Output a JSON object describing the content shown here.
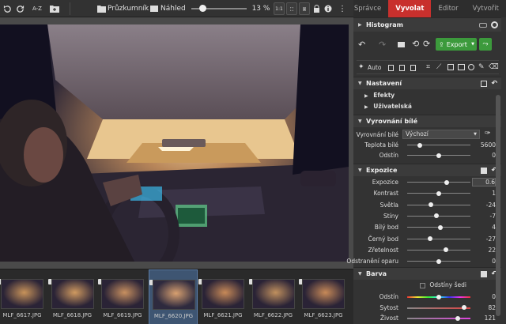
{
  "toolbar": {
    "browser_label": "Průzkumník",
    "preview_label": "Náhled",
    "zoom": "13 %",
    "zoom_fraction": 0.2,
    "sort_label": "A-Z"
  },
  "modes": [
    "Správce",
    "Vyvolat",
    "Editor",
    "Vytvořit"
  ],
  "active_mode": "Vyvolat",
  "panel": {
    "histogram_label": "Histogram",
    "export_label": "Export",
    "auto_label": "Auto",
    "settings_label": "Nastavení",
    "effects_label": "Efekty",
    "user_label": "Uživatelská",
    "wb_section": "Vyrovnání bílé",
    "wb_field_label": "Vyrovnání bílé",
    "wb_value": "Výchozí",
    "exposure_section": "Expozice",
    "color_section": "Barva",
    "gray_label": "Odstíny šedi"
  },
  "wb_rows": [
    {
      "label": "Teplota bílé",
      "value": "5600",
      "pos": 0.2
    },
    {
      "label": "Odstín",
      "value": "0",
      "pos": 0.5
    }
  ],
  "exposure_rows": [
    {
      "label": "Expozice",
      "value": "0.6",
      "pos": 0.62
    },
    {
      "label": "Kontrast",
      "value": "1",
      "pos": 0.5
    },
    {
      "label": "Světla",
      "value": "-24",
      "pos": 0.38
    },
    {
      "label": "Stíny",
      "value": "-7",
      "pos": 0.46
    },
    {
      "label": "Bílý bod",
      "value": "4",
      "pos": 0.52
    },
    {
      "label": "Černý bod",
      "value": "-27",
      "pos": 0.36
    },
    {
      "label": "Zřetelnost",
      "value": "22",
      "pos": 0.61
    },
    {
      "label": "Odstranění oparu",
      "value": "0",
      "pos": 0.5
    }
  ],
  "color_rows": [
    {
      "label": "Odstín",
      "value": "0",
      "pos": 0.5
    },
    {
      "label": "Sytost",
      "value": "82",
      "pos": 0.9
    },
    {
      "label": "Živost",
      "value": "121",
      "pos": 0.8
    }
  ],
  "thumbnails": [
    {
      "label": "MLF_6617.JPG"
    },
    {
      "label": "MLF_6618.JPG"
    },
    {
      "label": "MLF_6619.JPG"
    },
    {
      "label": "MLF_6620.JPG",
      "selected": true
    },
    {
      "label": "MLF_6621.JPG"
    },
    {
      "label": "MLF_6622.JPG"
    },
    {
      "label": "MLF_6623.JPG"
    }
  ],
  "colors": {
    "accent": "#c8302d",
    "export_green": "#3c9a3c",
    "selected_thumb": "#3e5572"
  }
}
